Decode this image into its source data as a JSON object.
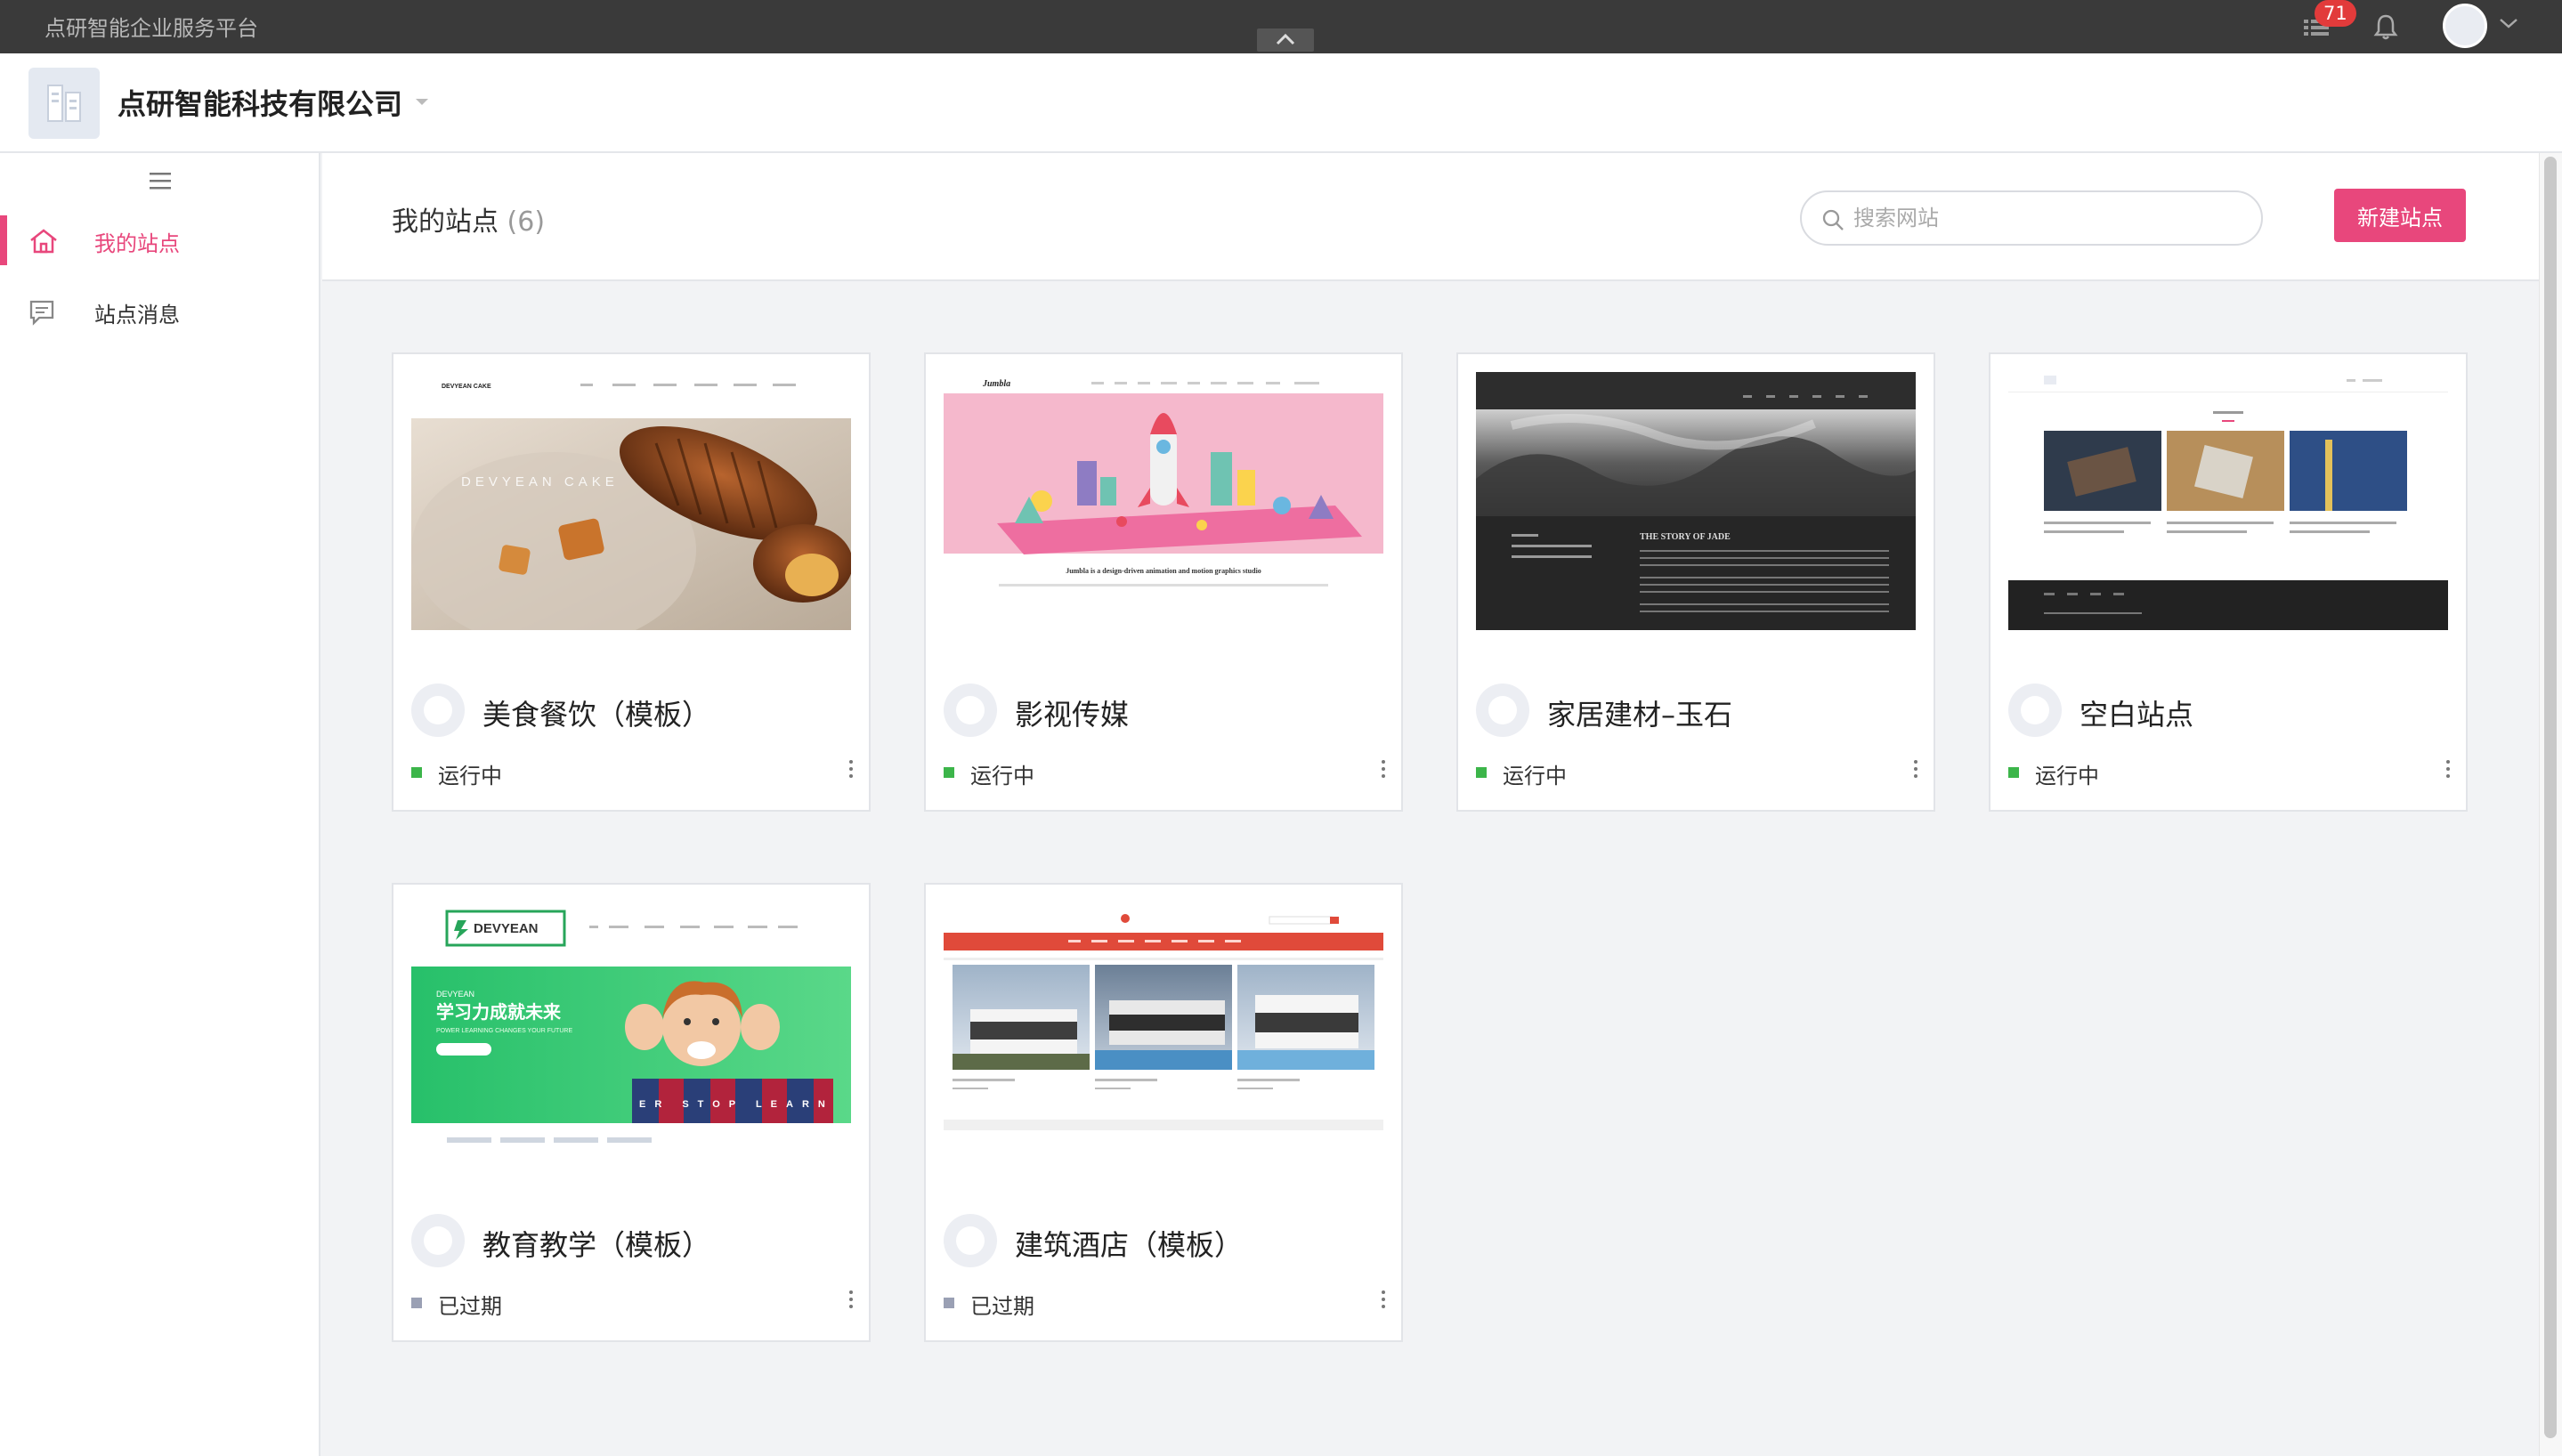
{
  "topbar": {
    "title": "点研智能企业服务平台",
    "badge_count": "71"
  },
  "header": {
    "company": "点研智能科技有限公司"
  },
  "sidebar": {
    "items": [
      {
        "label": "我的站点",
        "icon": "home-icon",
        "active": true
      },
      {
        "label": "站点消息",
        "icon": "message-icon",
        "active": false
      }
    ]
  },
  "content": {
    "title": "我的站点",
    "count": "(6)",
    "search_placeholder": "搜索网站",
    "new_button": "新建站点"
  },
  "colors": {
    "accent": "#e8477c",
    "running": "#3cb54a",
    "expired": "#9aa0b4"
  },
  "sites": [
    {
      "name": "美食餐饮（模板）",
      "status": "运行中",
      "status_type": "running",
      "thumb": "cake",
      "thumb_text": {
        "brand": "DEVYEAN CAKE",
        "hero": "DEVYEAN CAKE"
      }
    },
    {
      "name": "影视传媒",
      "status": "运行中",
      "status_type": "running",
      "thumb": "media",
      "thumb_text": {
        "brand": "Jumbla",
        "headline": "Jumbla is a design-driven animation and motion graphics studio"
      }
    },
    {
      "name": "家居建材–玉石",
      "status": "运行中",
      "status_type": "running",
      "thumb": "jade",
      "thumb_text": {
        "headline": "THE STORY OF JADE"
      }
    },
    {
      "name": "空白站点",
      "status": "运行中",
      "status_type": "running",
      "thumb": "blank",
      "thumb_text": {}
    },
    {
      "name": "教育教学（模板）",
      "status": "已过期",
      "status_type": "expired",
      "thumb": "edu",
      "thumb_text": {
        "brand": "DEVYEAN",
        "sub": "DEVYEAN",
        "headline": "学习力成就未来",
        "tagline": "POWER LEARNING CHANGES YOUR FUTURE",
        "blocks": "ER STOP LEARN"
      }
    },
    {
      "name": "建筑酒店（模板）",
      "status": "已过期",
      "status_type": "expired",
      "thumb": "hotel",
      "thumb_text": {}
    }
  ]
}
